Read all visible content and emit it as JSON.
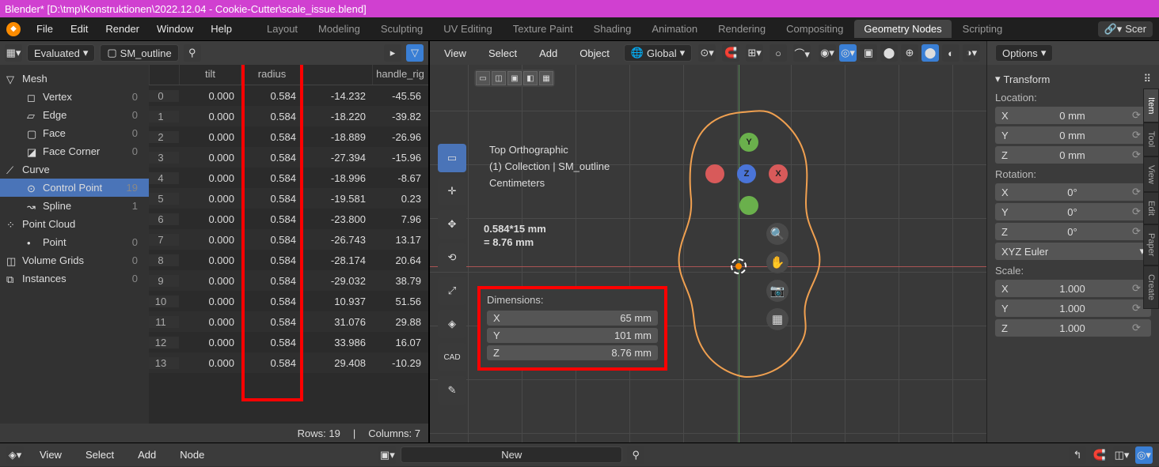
{
  "title": "Blender* [D:\\tmp\\Konstruktionen\\2022.12.04 - Cookie-Cutter\\scale_issue.blend]",
  "menubar": [
    "File",
    "Edit",
    "Render",
    "Window",
    "Help"
  ],
  "workspaces": [
    "Layout",
    "Modeling",
    "Sculpting",
    "UV Editing",
    "Texture Paint",
    "Shading",
    "Animation",
    "Rendering",
    "Compositing",
    "Geometry Nodes",
    "Scripting"
  ],
  "active_workspace": "Geometry Nodes",
  "recover_hint": "Scer",
  "spreadsheet": {
    "mode": "Evaluated",
    "object": "SM_outline",
    "tree": [
      {
        "name": "Mesh",
        "count": "",
        "level": 0,
        "icon": "▽"
      },
      {
        "name": "Vertex",
        "count": "0",
        "level": 1,
        "icon": "◻"
      },
      {
        "name": "Edge",
        "count": "0",
        "level": 1,
        "icon": "▱"
      },
      {
        "name": "Face",
        "count": "0",
        "level": 1,
        "icon": "▢"
      },
      {
        "name": "Face Corner",
        "count": "0",
        "level": 1,
        "icon": "◪"
      },
      {
        "name": "Curve",
        "count": "",
        "level": 0,
        "icon": "⟋"
      },
      {
        "name": "Control Point",
        "count": "19",
        "level": 1,
        "icon": "⊙",
        "selected": true
      },
      {
        "name": "Spline",
        "count": "1",
        "level": 1,
        "icon": "↝"
      },
      {
        "name": "Point Cloud",
        "count": "",
        "level": 0,
        "icon": "⁘"
      },
      {
        "name": "Point",
        "count": "0",
        "level": 1,
        "icon": "•"
      },
      {
        "name": "Volume Grids",
        "count": "0",
        "level": 0,
        "icon": "◫"
      },
      {
        "name": "Instances",
        "count": "0",
        "level": 0,
        "icon": "⧉"
      }
    ],
    "columns": [
      "tilt",
      "radius",
      "handle_rig"
    ],
    "rows": [
      {
        "i": 0,
        "tilt": "0.000",
        "radius": "0.584",
        "h": "-14.232",
        "h2": "-45.56"
      },
      {
        "i": 1,
        "tilt": "0.000",
        "radius": "0.584",
        "h": "-18.220",
        "h2": "-39.82"
      },
      {
        "i": 2,
        "tilt": "0.000",
        "radius": "0.584",
        "h": "-18.889",
        "h2": "-26.96"
      },
      {
        "i": 3,
        "tilt": "0.000",
        "radius": "0.584",
        "h": "-27.394",
        "h2": "-15.96"
      },
      {
        "i": 4,
        "tilt": "0.000",
        "radius": "0.584",
        "h": "-18.996",
        "h2": "-8.67"
      },
      {
        "i": 5,
        "tilt": "0.000",
        "radius": "0.584",
        "h": "-19.581",
        "h2": "0.23"
      },
      {
        "i": 6,
        "tilt": "0.000",
        "radius": "0.584",
        "h": "-23.800",
        "h2": "7.96"
      },
      {
        "i": 7,
        "tilt": "0.000",
        "radius": "0.584",
        "h": "-26.743",
        "h2": "13.17"
      },
      {
        "i": 8,
        "tilt": "0.000",
        "radius": "0.584",
        "h": "-28.174",
        "h2": "20.64"
      },
      {
        "i": 9,
        "tilt": "0.000",
        "radius": "0.584",
        "h": "-29.032",
        "h2": "38.79"
      },
      {
        "i": 10,
        "tilt": "0.000",
        "radius": "0.584",
        "h": "10.937",
        "h2": "51.56"
      },
      {
        "i": 11,
        "tilt": "0.000",
        "radius": "0.584",
        "h": "31.076",
        "h2": "29.88"
      },
      {
        "i": 12,
        "tilt": "0.000",
        "radius": "0.584",
        "h": "33.986",
        "h2": "16.07"
      },
      {
        "i": 13,
        "tilt": "0.000",
        "radius": "0.584",
        "h": "29.408",
        "h2": "-10.29"
      }
    ],
    "footer_rows": "Rows:  19",
    "footer_cols": "Columns: 7"
  },
  "viewport": {
    "menus": [
      "View",
      "Select",
      "Add",
      "Object"
    ],
    "orient": "Global",
    "overlay_lines": [
      "Top Orthographic",
      "(1) Collection | SM_outline",
      "Centimeters"
    ],
    "calc_lines": [
      "0.584*15 mm",
      "= 8.76 mm"
    ],
    "dim_title": "Dimensions:",
    "dims": [
      [
        "X",
        "65 mm"
      ],
      [
        "Y",
        "101 mm"
      ],
      [
        "Z",
        "8.76 mm"
      ]
    ],
    "options_label": "Options"
  },
  "npanel": {
    "title": "Transform",
    "location_label": "Location:",
    "rotation_label": "Rotation:",
    "scale_label": "Scale:",
    "rot_mode": "XYZ Euler",
    "loc": [
      [
        "X",
        "0 mm"
      ],
      [
        "Y",
        "0 mm"
      ],
      [
        "Z",
        "0 mm"
      ]
    ],
    "rot": [
      [
        "X",
        "0°"
      ],
      [
        "Y",
        "0°"
      ],
      [
        "Z",
        "0°"
      ]
    ],
    "scale": [
      [
        "X",
        "1.000"
      ],
      [
        "Y",
        "1.000"
      ],
      [
        "Z",
        "1.000"
      ]
    ],
    "tabs": [
      "Item",
      "Tool",
      "View",
      "Edit",
      "Paper",
      "Create"
    ]
  },
  "bottombar": {
    "menus": [
      "View",
      "Select",
      "Add",
      "Node"
    ],
    "center": "New"
  }
}
